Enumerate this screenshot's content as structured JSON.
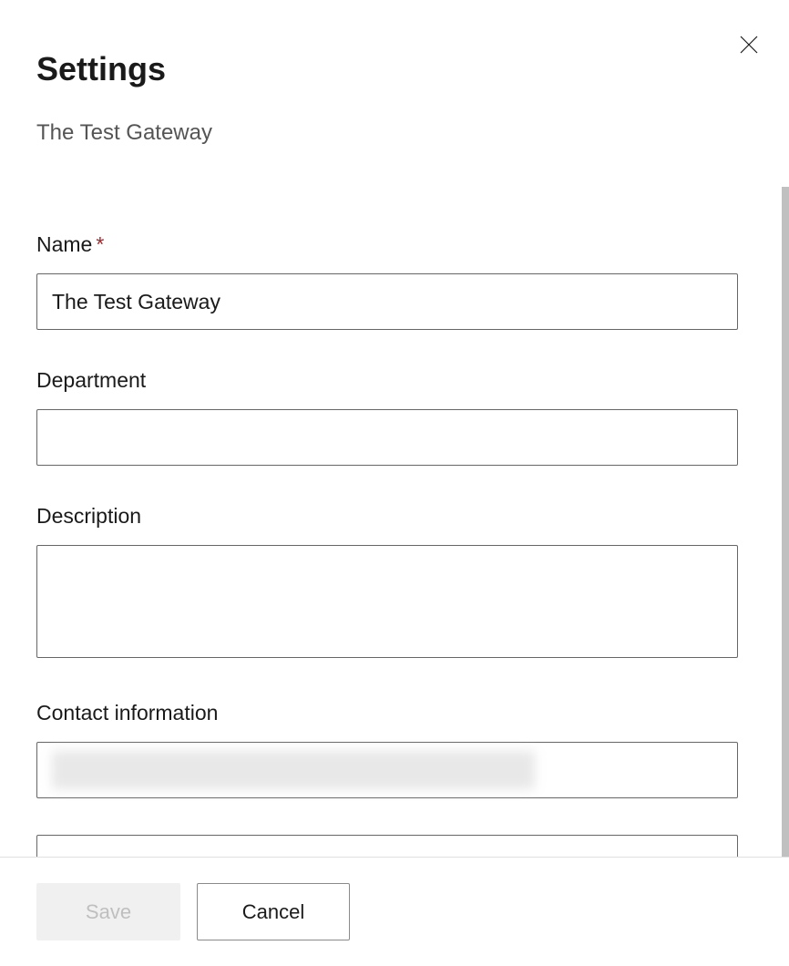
{
  "header": {
    "title": "Settings",
    "subtitle": "The Test Gateway"
  },
  "fields": {
    "name": {
      "label": "Name",
      "required": true,
      "value": "The Test Gateway"
    },
    "department": {
      "label": "Department",
      "value": ""
    },
    "description": {
      "label": "Description",
      "value": ""
    },
    "contact": {
      "label": "Contact information",
      "value": ""
    }
  },
  "footer": {
    "save_label": "Save",
    "cancel_label": "Cancel"
  }
}
